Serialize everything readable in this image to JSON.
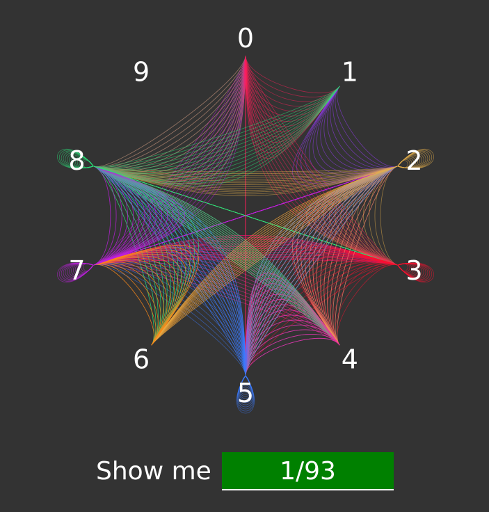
{
  "digits": [
    "0",
    "1",
    "2",
    "3",
    "4",
    "5",
    "6",
    "7",
    "8",
    "9"
  ],
  "sequence": [
    0,
    1,
    2,
    7,
    8,
    8,
    0,
    5,
    4,
    7,
    3,
    3,
    5,
    7,
    2,
    2,
    3,
    8,
    6,
    2,
    5,
    5,
    2,
    5,
    8,
    0,
    3,
    7,
    2,
    8,
    3,
    4,
    8,
    4,
    2,
    4,
    5,
    8,
    6,
    7,
    7,
    0,
    8,
    4,
    5,
    2,
    6,
    7,
    8,
    1
  ],
  "colors": {
    "0": "#ff1f5a",
    "1": "#9b3cff",
    "2": "#e8b04a",
    "3": "#ff1030",
    "4": "#ff2aa0",
    "5": "#3c7bff",
    "6": "#ff8a1a",
    "7": "#c020e0",
    "8": "#2ce07a",
    "9": "#40ffd0"
  },
  "controls": {
    "label": "Show me",
    "counter": "1/93"
  }
}
